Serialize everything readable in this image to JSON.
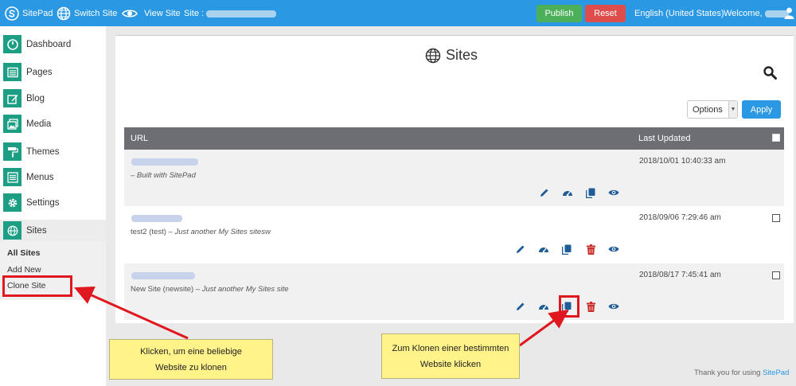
{
  "topbar": {
    "brand": "SitePad",
    "switch_site": "Switch Site",
    "view_site": "View Site",
    "site_label": "Site :",
    "publish": "Publish",
    "reset": "Reset",
    "language": "English (United States)",
    "welcome": "Welcome,"
  },
  "sidebar": {
    "items": [
      {
        "label": "Dashboard",
        "icon": "dashboard-icon"
      },
      {
        "label": "Pages",
        "icon": "pages-icon"
      },
      {
        "label": "Blog",
        "icon": "blog-icon"
      },
      {
        "label": "Media",
        "icon": "media-icon"
      },
      {
        "label": "Themes",
        "icon": "themes-icon"
      },
      {
        "label": "Menus",
        "icon": "menus-icon"
      },
      {
        "label": "Settings",
        "icon": "settings-icon"
      },
      {
        "label": "Sites",
        "icon": "globe-icon"
      }
    ],
    "submenu": [
      "All Sites",
      "Add New",
      "Clone Site"
    ]
  },
  "main": {
    "title": "Sites",
    "options_label": "Options",
    "apply_label": "Apply",
    "columns": [
      "URL",
      "Last Updated"
    ],
    "rows": [
      {
        "desc_plain": "",
        "desc_italic": "– Built with SitePad",
        "updated": "2018/10/01 10:40:33 am",
        "has_checkbox": false,
        "has_delete": false
      },
      {
        "desc_plain": "test2 (test) ",
        "desc_italic": "– Just another My Sites sitesw",
        "updated": "2018/09/06 7:29:46 am",
        "has_checkbox": true,
        "has_delete": true
      },
      {
        "desc_plain": "New Site (newsite) ",
        "desc_italic": "– Just another My Sites site",
        "updated": "2018/08/17 7:45:41 am",
        "has_checkbox": true,
        "has_delete": true
      }
    ]
  },
  "footer": {
    "text": "Thank you for using ",
    "brand": "SitePad"
  },
  "annotations": {
    "callout_left": "Klicken, um eine beliebige Website zu klonen",
    "callout_right": "Zum Klonen einer bestimmten Website klicken",
    "highlight_color": "#e0171e",
    "callout_color": "#fff38a"
  },
  "colors": {
    "accent": "#2a98e3",
    "sidebar_icon": "#1b9e83",
    "publish": "#4cb05a",
    "reset": "#df4c4c",
    "action_icon": "#1f5d99",
    "delete_icon": "#c9302c"
  }
}
